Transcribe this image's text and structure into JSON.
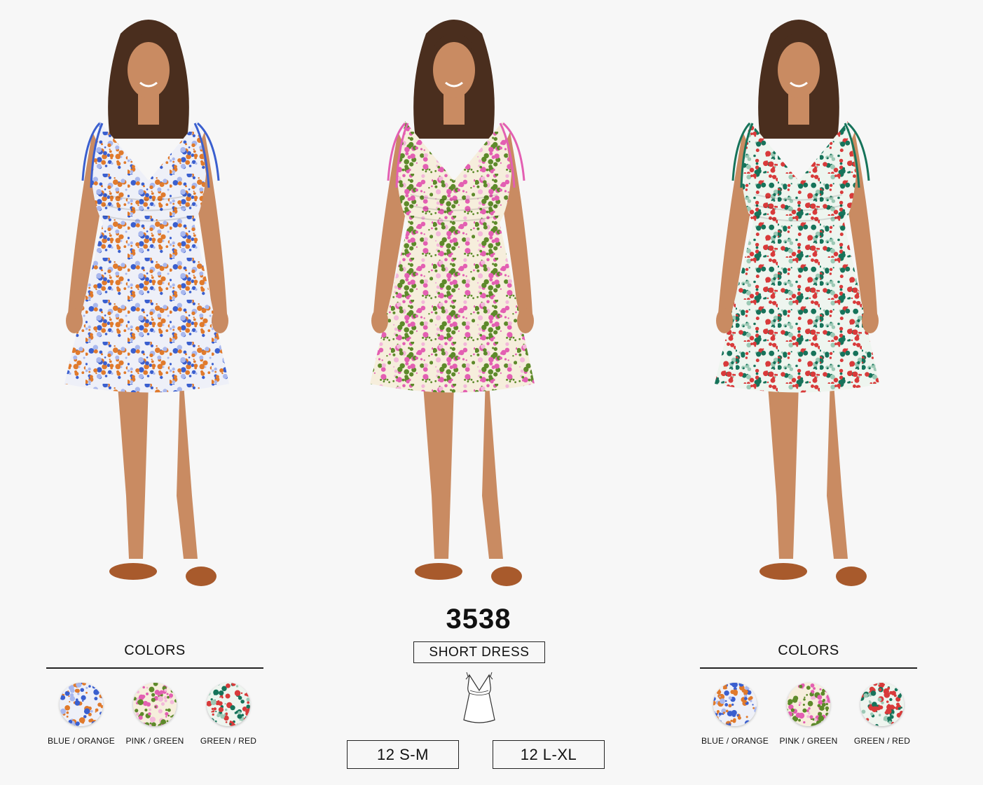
{
  "product": {
    "style_number": "3538",
    "type": "SHORT DRESS",
    "sizes": [
      "12 S-M",
      "12 L-XL"
    ]
  },
  "colors_left": {
    "title": "COLORS",
    "items": [
      {
        "label": "BLUE / ORANGE"
      },
      {
        "label": "PINK / GREEN"
      },
      {
        "label": "GREEN / RED"
      }
    ]
  },
  "colors_right": {
    "title": "COLORS",
    "items": [
      {
        "label": "BLUE / ORANGE"
      },
      {
        "label": "PINK / GREEN"
      },
      {
        "label": "GREEN / RED"
      }
    ]
  },
  "palette": {
    "blue_orange": {
      "base": "#eef0f8",
      "a": "#3a5fcf",
      "b": "#e07a2c",
      "c": "#a9b8ee"
    },
    "pink_green": {
      "base": "#f6eedc",
      "a": "#e35fb2",
      "b": "#5d8a2a",
      "c": "#f3b7d9"
    },
    "green_red": {
      "base": "#eef5ef",
      "a": "#16735a",
      "b": "#d83a3a",
      "c": "#9cc9b5"
    },
    "skin": "#c98b62",
    "hair": "#4a2e1e",
    "sandal": "#a85a2c"
  }
}
